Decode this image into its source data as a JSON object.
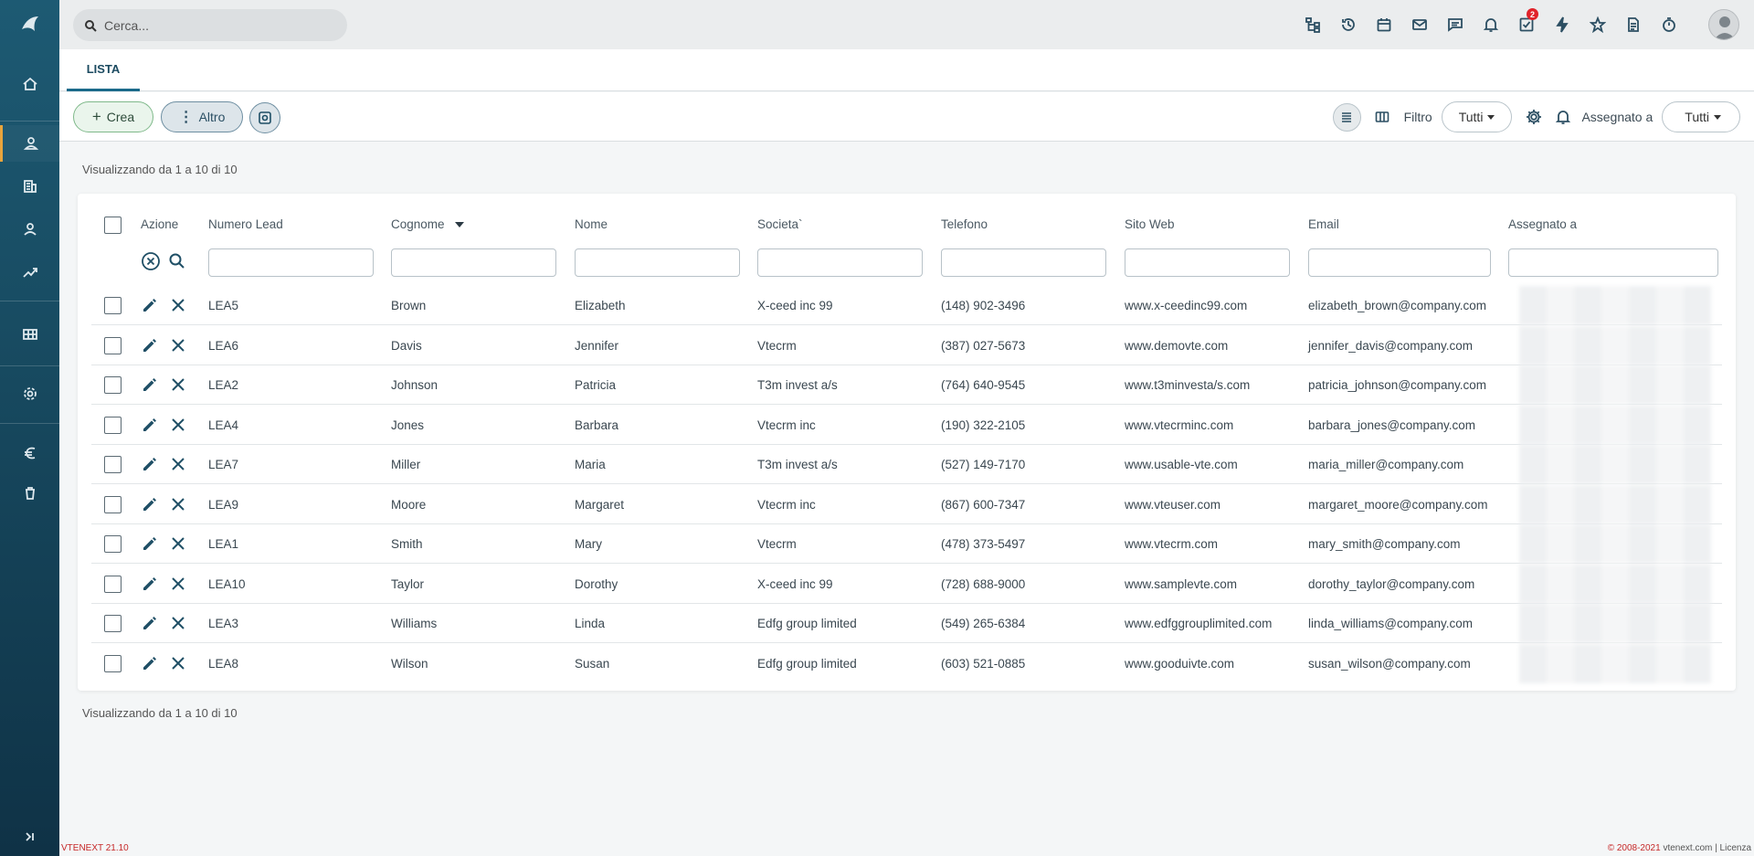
{
  "app": {
    "version": "VTENEXT 21.10",
    "copyright": "© 2008-2021",
    "site": "vtenext.com",
    "license": "Licenza"
  },
  "search": {
    "placeholder": "Cerca..."
  },
  "topbar": {
    "icons": [
      "sitemap-icon",
      "history-icon",
      "calendar-icon",
      "mail-icon",
      "chat-icon",
      "bell-icon",
      "tasks-icon",
      "bolt-icon",
      "star-icon",
      "document-icon",
      "timer-icon"
    ],
    "tasks_badge": "2"
  },
  "sidebar": {
    "items": [
      "home",
      "leads",
      "accounts",
      "contacts",
      "potentials",
      "modules-grid",
      "settings",
      "euro",
      "trash"
    ],
    "active": "leads"
  },
  "tabs": [
    {
      "label": "LISTA",
      "active": true
    }
  ],
  "toolbar": {
    "create_label": "Crea",
    "more_label": "Altro",
    "filter_label": "Filtro",
    "filter_value": "Tutti",
    "assigned_label": "Assegnato a",
    "assigned_value": "Tutti"
  },
  "summary": {
    "top": "Visualizzando da 1 a 10 di 10",
    "bottom": "Visualizzando da 1 a 10 di 10"
  },
  "table": {
    "columns": [
      "Azione",
      "Numero Lead",
      "Cognome",
      "Nome",
      "Societa`",
      "Telefono",
      "Sito Web",
      "Email",
      "Assegnato a"
    ],
    "sorted_column": "Cognome",
    "rows": [
      {
        "lead": "LEA5",
        "last": "Brown",
        "first": "Elizabeth",
        "company": "X-ceed inc 99",
        "phone": "(148) 902-3496",
        "web": "www.x-ceedinc99.com",
        "email": "elizabeth_brown@company.com"
      },
      {
        "lead": "LEA6",
        "last": "Davis",
        "first": "Jennifer",
        "company": "Vtecrm",
        "phone": "(387) 027-5673",
        "web": "www.demovte.com",
        "email": "jennifer_davis@company.com"
      },
      {
        "lead": "LEA2",
        "last": "Johnson",
        "first": "Patricia",
        "company": "T3m invest a/s",
        "phone": "(764) 640-9545",
        "web": "www.t3minvesta/s.com",
        "email": "patricia_johnson@company.com"
      },
      {
        "lead": "LEA4",
        "last": "Jones",
        "first": "Barbara",
        "company": "Vtecrm inc",
        "phone": "(190) 322-2105",
        "web": "www.vtecrminc.com",
        "email": "barbara_jones@company.com"
      },
      {
        "lead": "LEA7",
        "last": "Miller",
        "first": "Maria",
        "company": "T3m invest a/s",
        "phone": "(527) 149-7170",
        "web": "www.usable-vte.com",
        "email": "maria_miller@company.com"
      },
      {
        "lead": "LEA9",
        "last": "Moore",
        "first": "Margaret",
        "company": "Vtecrm inc",
        "phone": "(867) 600-7347",
        "web": "www.vteuser.com",
        "email": "margaret_moore@company.com"
      },
      {
        "lead": "LEA1",
        "last": "Smith",
        "first": "Mary",
        "company": "Vtecrm",
        "phone": "(478) 373-5497",
        "web": "www.vtecrm.com",
        "email": "mary_smith@company.com"
      },
      {
        "lead": "LEA10",
        "last": "Taylor",
        "first": "Dorothy",
        "company": "X-ceed inc 99",
        "phone": "(728) 688-9000",
        "web": "www.samplevte.com",
        "email": "dorothy_taylor@company.com"
      },
      {
        "lead": "LEA3",
        "last": "Williams",
        "first": "Linda",
        "company": "Edfg group limited",
        "phone": "(549) 265-6384",
        "web": "www.edfggrouplimited.com",
        "email": "linda_williams@company.com"
      },
      {
        "lead": "LEA8",
        "last": "Wilson",
        "first": "Susan",
        "company": "Edfg group limited",
        "phone": "(603) 521-0885",
        "web": "www.gooduivte.com",
        "email": "susan_wilson@company.com"
      }
    ]
  },
  "colors": {
    "sidebar": "#17495f",
    "accent": "#e8a43c",
    "badge": "#e0232a"
  }
}
